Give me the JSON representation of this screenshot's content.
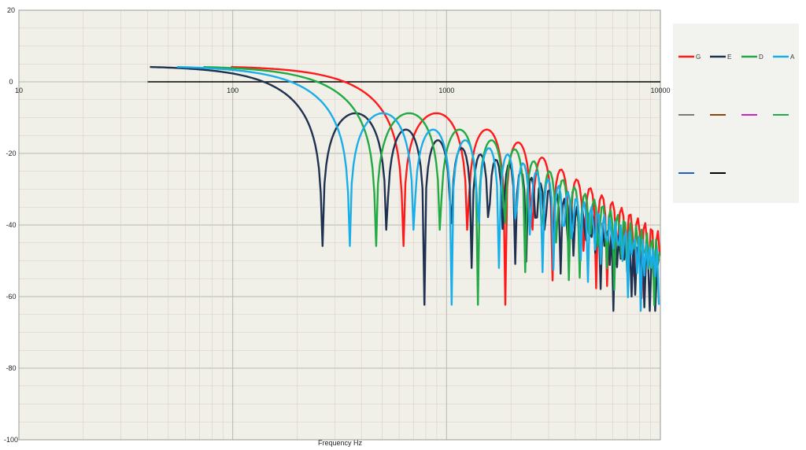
{
  "chart_data": {
    "type": "line",
    "xlabel": "Frequency Hz",
    "ylabel": "",
    "x_scale": "log",
    "xlim": [
      10,
      10000
    ],
    "ylim": [
      -100,
      20
    ],
    "x_ticks": [
      "10",
      "100",
      "1000",
      "10000"
    ],
    "y_ticks": [
      "20",
      "0",
      "-20",
      "-40",
      "-60",
      "-80",
      "-100"
    ],
    "grid": true,
    "legend_position": "right",
    "colors": {
      "background": "#f0f0e8",
      "minor_grid": "#e3c9c9",
      "major_grid": "#b8b8b0",
      "zero_line": "#000000"
    },
    "reference_line": {
      "y": 0,
      "x_start": 40,
      "x_end": 10000,
      "color": "#000000"
    },
    "series": [
      {
        "name": "G",
        "color": "#ff1a1a",
        "f0": 98,
        "start": 98
      },
      {
        "name": "E",
        "color": "#1f3150",
        "f0": 41,
        "start": 41
      },
      {
        "name": "D",
        "color": "#22aa44",
        "f0": 73,
        "start": 73
      },
      {
        "name": "A",
        "color": "#1aaee8",
        "f0": 55,
        "start": 55
      }
    ],
    "legend_extra": [
      {
        "color": "#7a7a7a"
      },
      {
        "color": "#8b4513"
      },
      {
        "color": "#cc22cc"
      },
      {
        "color": "#22aa44"
      },
      {
        "color": "#1f5fbf"
      },
      {
        "color": "#000000"
      }
    ]
  }
}
